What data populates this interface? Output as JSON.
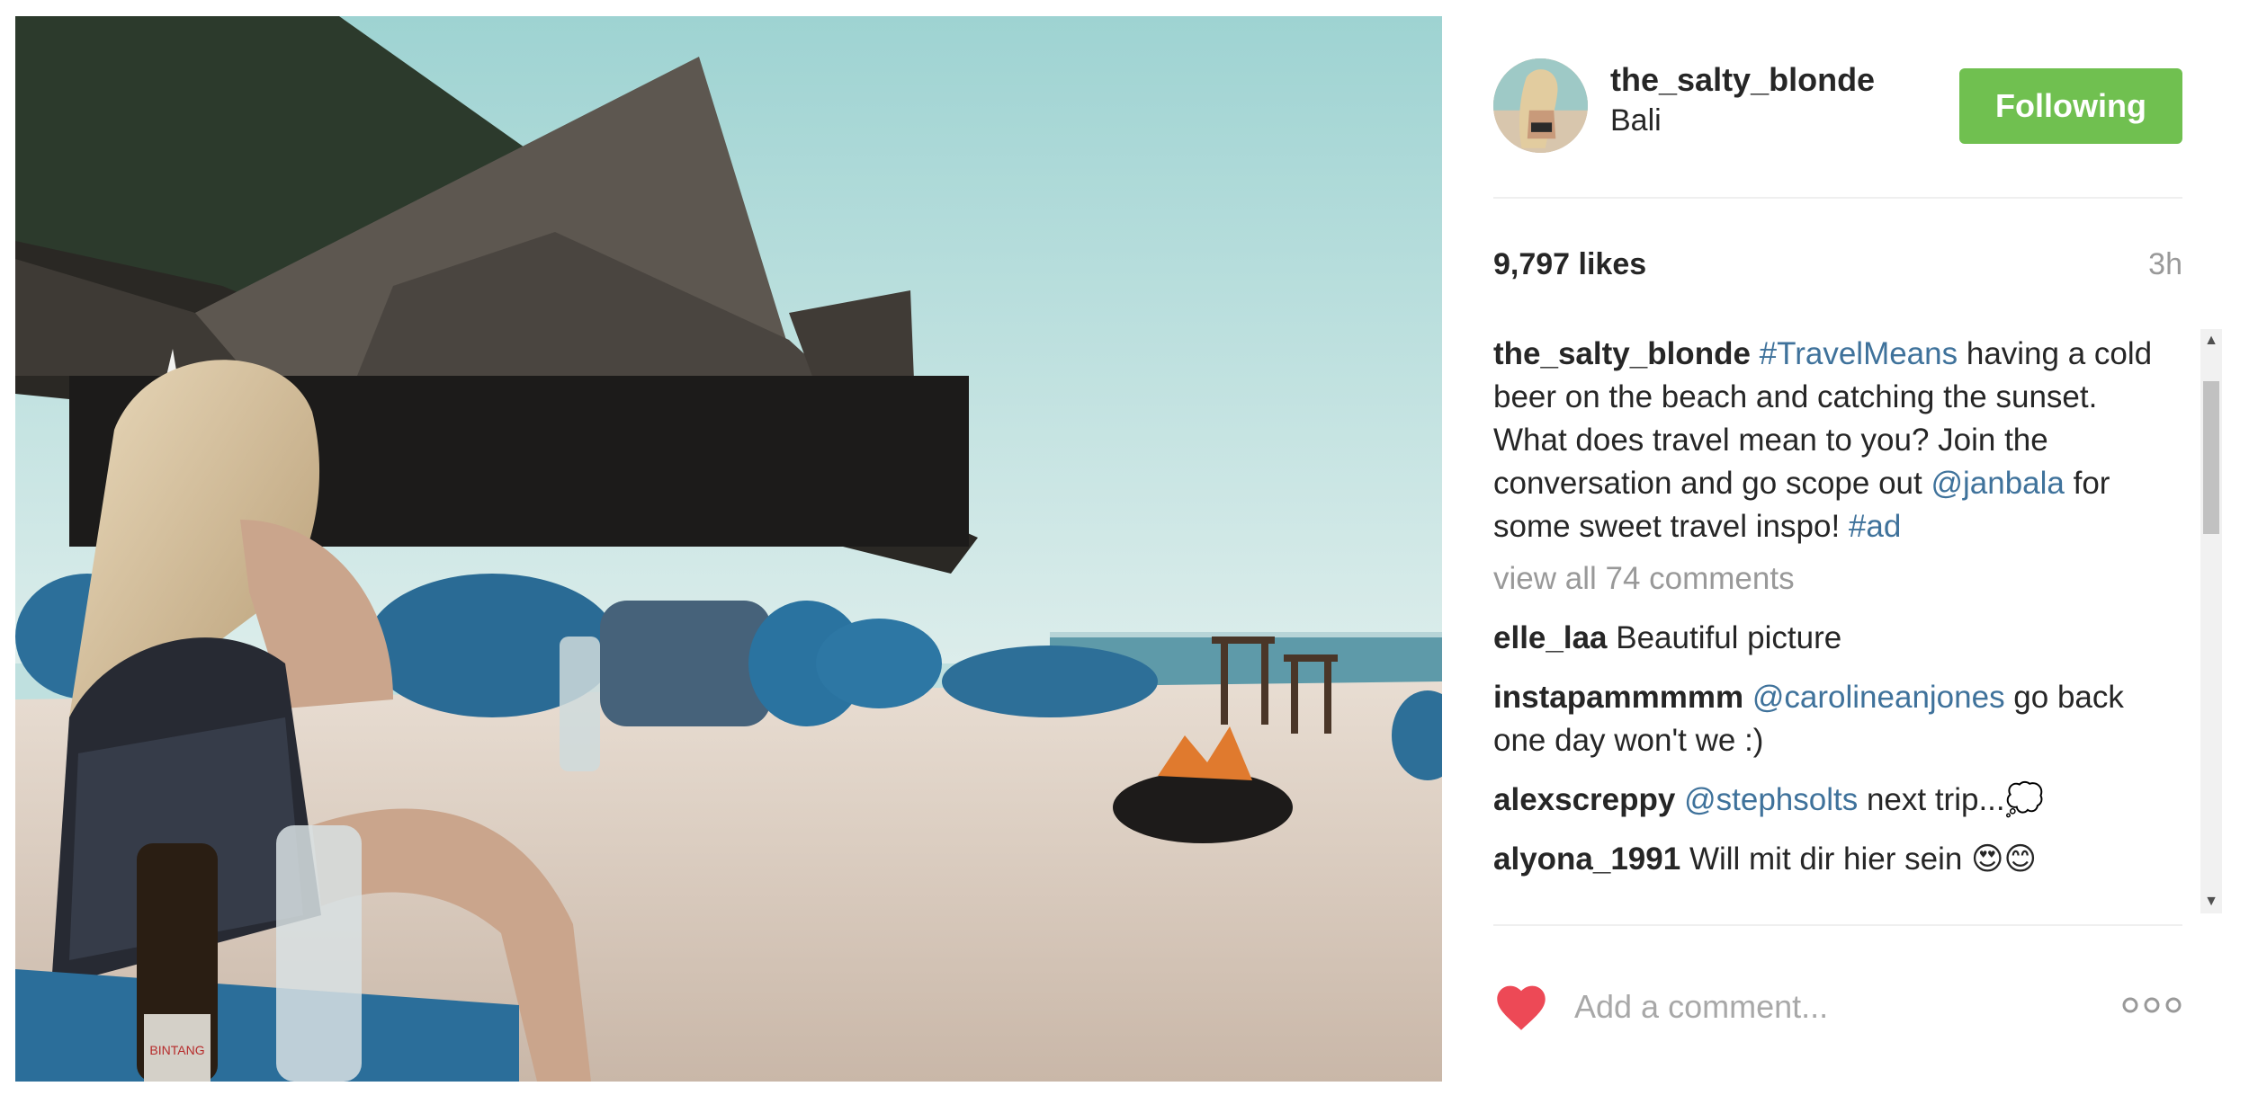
{
  "post": {
    "author": "the_salty_blonde",
    "location": "Bali",
    "follow_label": "Following",
    "likes": "9,797 likes",
    "time_ago": "3h",
    "caption": {
      "username": "the_salty_blonde",
      "tag1": "#TravelMeans",
      "text1": " having a cold beer on the beach and catching the sunset. What does travel mean to you? Join the conversation and go scope out ",
      "mention": "@janbala",
      "text2": " for some sweet travel inspo! ",
      "tag2": "#ad"
    },
    "view_all_comments": "view all 74 comments",
    "comments": [
      {
        "username": "elle_laa",
        "text": " Beautiful picture"
      },
      {
        "username": "instapammmmm",
        "mention": "@carolineanjones",
        "text": " go back one day won't we :)"
      },
      {
        "username": "alexscreppy",
        "mention": "@stephsolts",
        "text": " next trip...💭"
      },
      {
        "username": "alyona_1991",
        "text": " Will mit dir hier sein 😍😊"
      }
    ],
    "add_comment_placeholder": "Add a comment...",
    "bottle_label": "BINTANG"
  },
  "colors": {
    "follow_button": "#70c050",
    "heart": "#ed4956",
    "hashtag": "#3f729b",
    "muted_text": "#999999"
  },
  "icons": [
    "heart-icon",
    "more-options-icon",
    "scroll-up-icon",
    "scroll-down-icon"
  ]
}
